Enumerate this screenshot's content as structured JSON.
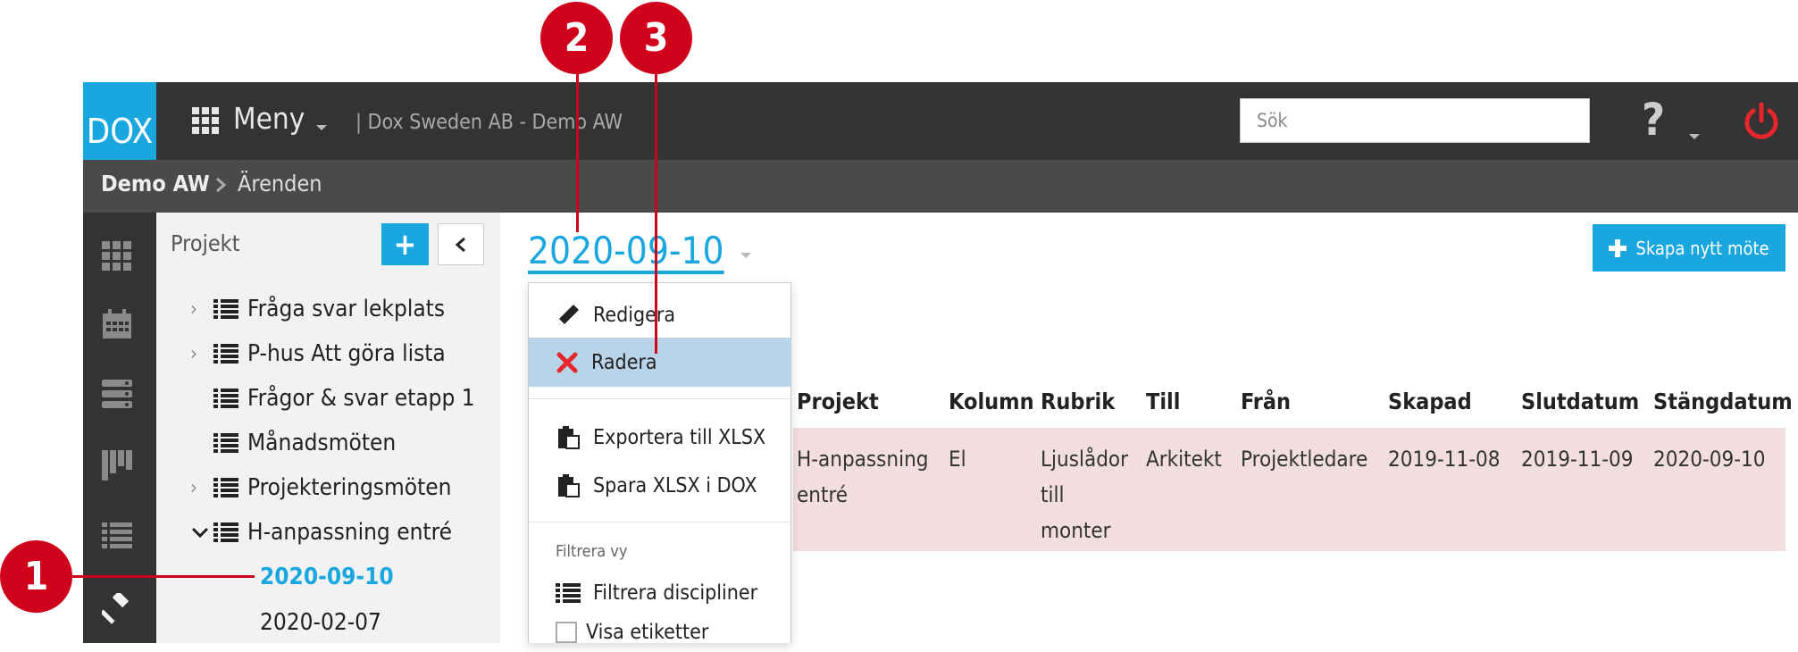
{
  "app": {
    "logo": "DOX",
    "menu_label": "Meny",
    "company": "| Dox Sweden AB - Demo AW",
    "search_placeholder": "Sök",
    "help_glyph": "?"
  },
  "breadcrumb": {
    "items": [
      "Demo AW",
      "Ärenden"
    ]
  },
  "sidebar": {
    "title": "Projekt",
    "add_glyph": "+",
    "items": [
      {
        "label": "Fråga svar lekplats",
        "expandable": true
      },
      {
        "label": "P-hus Att göra lista",
        "expandable": true
      },
      {
        "label": "Frågor & svar etapp 1",
        "expandable": false
      },
      {
        "label": "Månadsmöten",
        "expandable": false
      },
      {
        "label": "Projekteringsmöten",
        "expandable": true
      },
      {
        "label": "H-anpassning entré",
        "expandable": true,
        "expanded": true
      }
    ],
    "sub_items": [
      {
        "label": "2020-09-10",
        "active": true
      },
      {
        "label": "2020-02-07",
        "active": false
      }
    ]
  },
  "main": {
    "title": "2020-09-10",
    "new_meeting_label": "Skapa nytt möte",
    "table": {
      "headers": [
        "Projekt",
        "Kolumn",
        "Rubrik",
        "Till",
        "Från",
        "Skapad",
        "Slutdatum",
        "Stängdatum"
      ],
      "rows": [
        {
          "projekt": [
            "H-anpassning",
            "entré"
          ],
          "kolumn": "El",
          "rubrik": [
            "Ljuslådor",
            "till",
            "monter"
          ],
          "till": "Arkitekt",
          "fran": "Projektledare",
          "skapad": "2019-11-08",
          "slutdatum": "2019-11-09",
          "stangdatum": "2020-09-10"
        }
      ]
    }
  },
  "dropdown": {
    "items": [
      {
        "label": "Redigera",
        "icon": "pencil-icon"
      },
      {
        "label": "Radera",
        "icon": "delete-x-icon",
        "highlighted": true
      },
      {
        "label": "Exportera till XLSX",
        "icon": "clipboard-icon"
      },
      {
        "label": "Spara XLSX i DOX",
        "icon": "clipboard-icon"
      }
    ],
    "filter_heading": "Filtrera vy",
    "filter_items": [
      {
        "label": "Filtrera discipliner",
        "icon": "list-icon"
      },
      {
        "label": "Visa etiketter",
        "icon": "checkbox"
      }
    ]
  },
  "callouts": [
    "1",
    "2",
    "3"
  ],
  "colors": {
    "accent": "#1aa7e0",
    "topbar": "#333333",
    "callout": "#d0021b",
    "highlight": "#b9d4e9",
    "row_bg": "#f2dede"
  }
}
